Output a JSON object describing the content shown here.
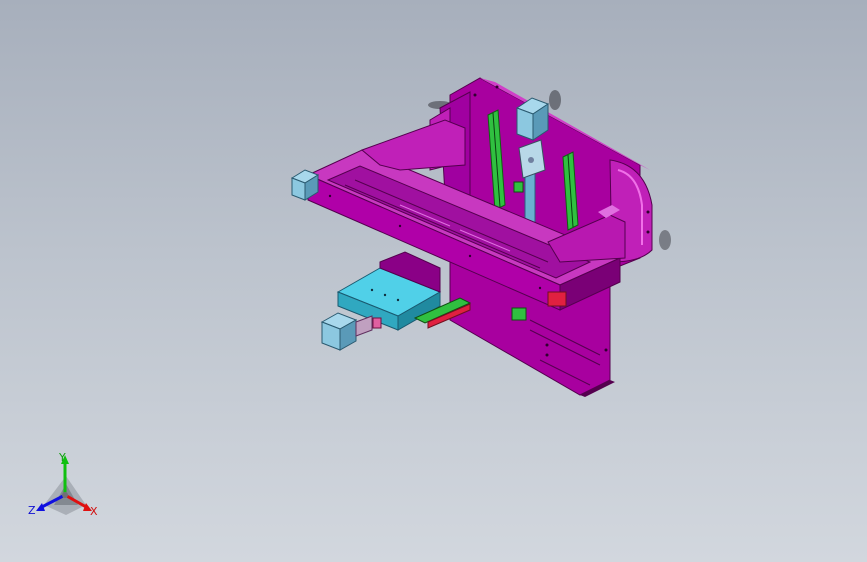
{
  "colors": {
    "frame": "#b000a8",
    "frame_dark": "#7a0076",
    "frame_light": "#d040c8",
    "motor": "#8cc8e0",
    "motor_dark": "#5a9ab8",
    "table": "#40c0d8",
    "rail": "#30c040",
    "accent_red": "#e02040",
    "axis_x": "#e01010",
    "axis_y": "#10c010",
    "axis_z": "#1010e0"
  },
  "icons": {
    "triad": "coordinate-triad-icon"
  },
  "triad": {
    "x_label": "X",
    "y_label": "Y",
    "z_label": "Z"
  }
}
